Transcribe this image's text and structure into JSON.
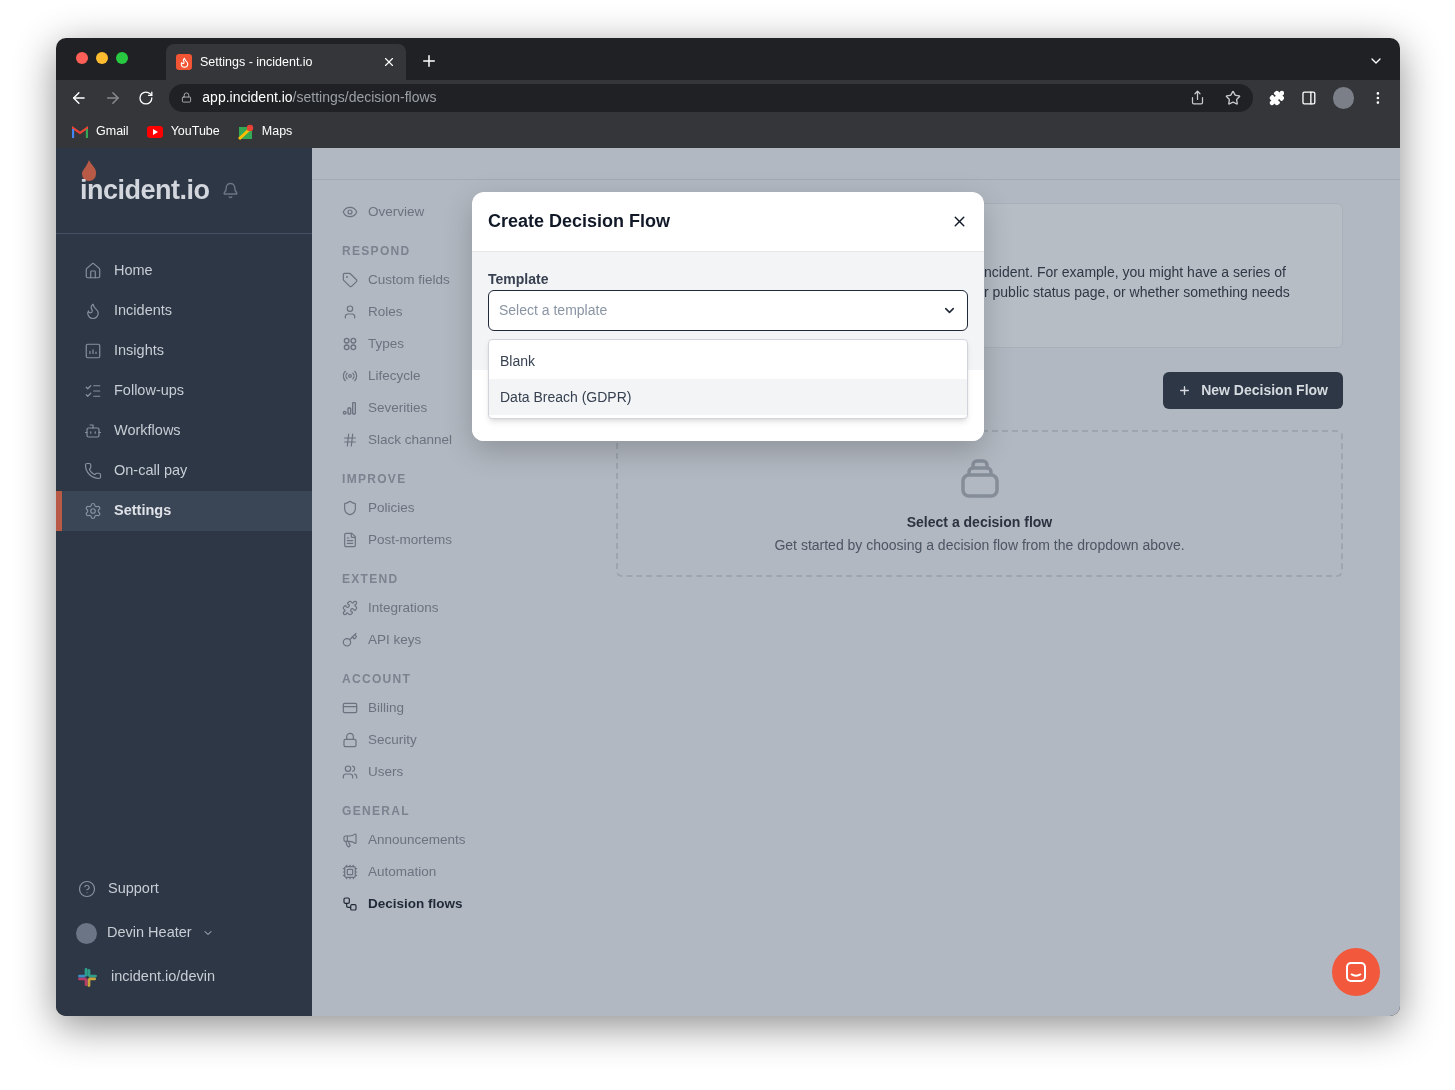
{
  "browser": {
    "tab": {
      "title": "Settings - incident.io"
    },
    "url": {
      "host": "app.incident.io",
      "path": "/settings/decision-flows"
    },
    "bookmarks": [
      "Gmail",
      "YouTube",
      "Maps"
    ]
  },
  "sidebar": {
    "logo": "incident.io",
    "items": [
      {
        "label": "Home",
        "selected": false
      },
      {
        "label": "Incidents",
        "selected": false
      },
      {
        "label": "Insights",
        "selected": false
      },
      {
        "label": "Follow-ups",
        "selected": false
      },
      {
        "label": "Workflows",
        "selected": false
      },
      {
        "label": "On-call pay",
        "selected": false
      },
      {
        "label": "Settings",
        "selected": true
      }
    ],
    "support": "Support",
    "user": "Devin Heater",
    "workspace": "incident.io/devin"
  },
  "settings_nav": {
    "overview": {
      "label": "Overview",
      "selected": false
    },
    "sections": [
      {
        "heading": "RESPOND",
        "items": [
          {
            "label": "Custom fields",
            "selected": false
          },
          {
            "label": "Roles",
            "selected": false
          },
          {
            "label": "Types",
            "selected": false
          },
          {
            "label": "Lifecycle",
            "selected": false
          },
          {
            "label": "Severities",
            "selected": false
          },
          {
            "label": "Slack channel",
            "selected": false
          }
        ]
      },
      {
        "heading": "IMPROVE",
        "items": [
          {
            "label": "Policies",
            "selected": false
          },
          {
            "label": "Post-mortems",
            "selected": false
          }
        ]
      },
      {
        "heading": "EXTEND",
        "items": [
          {
            "label": "Integrations",
            "selected": false
          },
          {
            "label": "API keys",
            "selected": false
          }
        ]
      },
      {
        "heading": "ACCOUNT",
        "items": [
          {
            "label": "Billing",
            "selected": false
          },
          {
            "label": "Security",
            "selected": false
          },
          {
            "label": "Users",
            "selected": false
          }
        ]
      },
      {
        "heading": "GENERAL",
        "items": [
          {
            "label": "Announcements",
            "selected": false
          },
          {
            "label": "Automation",
            "selected": false
          },
          {
            "label": "Decision flows",
            "selected": true
          }
        ]
      }
    ]
  },
  "content": {
    "description_lines": [
      "ncident. For example, you might have a series of",
      "r public status page, or whether something needs"
    ],
    "new_button": "New Decision Flow",
    "empty_state": {
      "title": "Select a decision flow",
      "text": "Get started by choosing a decision flow from the dropdown above."
    }
  },
  "modal": {
    "title": "Create Decision Flow",
    "field": {
      "label": "Template",
      "placeholder": "Select a template"
    },
    "options": [
      {
        "label": "Blank",
        "highlighted": false
      },
      {
        "label": "Data Breach (GDPR)",
        "highlighted": true
      }
    ]
  }
}
